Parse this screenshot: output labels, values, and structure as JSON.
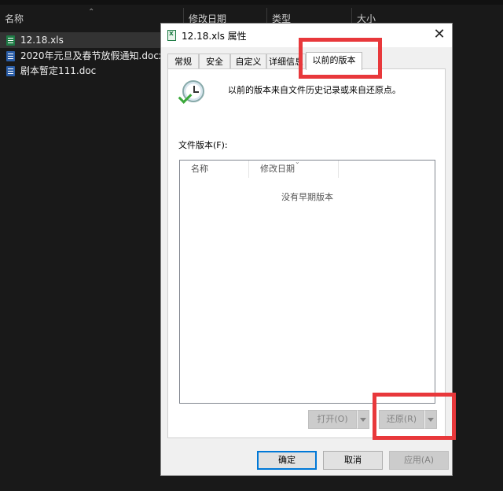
{
  "explorer": {
    "columns": {
      "name": "名称",
      "modified": "修改日期",
      "type": "类型",
      "size": "大小"
    },
    "files": [
      {
        "name": "12.18.xls",
        "kind": "xls"
      },
      {
        "name": "2020年元旦及春节放假通知.docx",
        "kind": "doc"
      },
      {
        "name": "剧本暂定111.doc",
        "kind": "doc"
      }
    ]
  },
  "dialog": {
    "title": "12.18.xls 属性",
    "close": "✕",
    "tabs": [
      {
        "label": "常规"
      },
      {
        "label": "安全"
      },
      {
        "label": "自定义"
      },
      {
        "label": "详细信息"
      },
      {
        "label": "以前的版本"
      }
    ],
    "description": "以前的版本来自文件历史记录或来自还原点。",
    "file_versions_label": "文件版本(F):",
    "list": {
      "col_name": "名称",
      "col_modified": "修改日期",
      "empty": "没有早期版本"
    },
    "open_button": "打开(O)",
    "restore_button": "还原(R)",
    "ok_button": "确定",
    "cancel_button": "取消",
    "apply_button": "应用(A)"
  },
  "colors": {
    "highlight": "#e8383b",
    "explorer_bg": "#191919",
    "dialog_bg": "#f0f0f0"
  }
}
